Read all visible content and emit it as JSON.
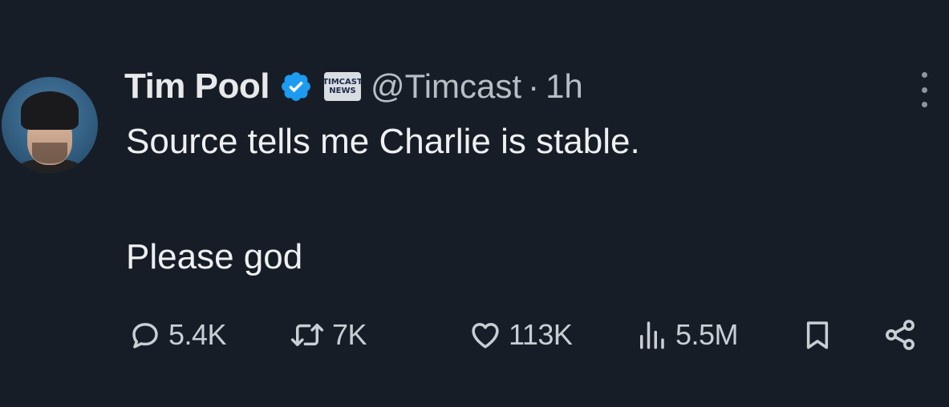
{
  "tweet": {
    "author": {
      "name": "Tim Pool",
      "handle": "@Timcast",
      "verified": true,
      "affiliate_badge_text": [
        "TIMCAST",
        "NEWS"
      ]
    },
    "separator": "·",
    "time": "1h",
    "text_lines": [
      "Source tells me Charlie is stable.",
      "Please god"
    ],
    "stats": {
      "replies": "5.4K",
      "reposts": "7K",
      "likes": "113K",
      "views": "5.5M"
    }
  },
  "colors": {
    "background": "#171d27",
    "text": "#e7e9ea",
    "muted": "#b9bec4",
    "verified_blue": "#1d9bf0"
  },
  "icons": {
    "reply": "reply-icon",
    "retweet": "retweet-icon",
    "like": "heart-icon",
    "views": "views-icon",
    "bookmark": "bookmark-icon",
    "share": "share-icon",
    "more": "more-icon",
    "verified": "verified-badge-icon"
  }
}
